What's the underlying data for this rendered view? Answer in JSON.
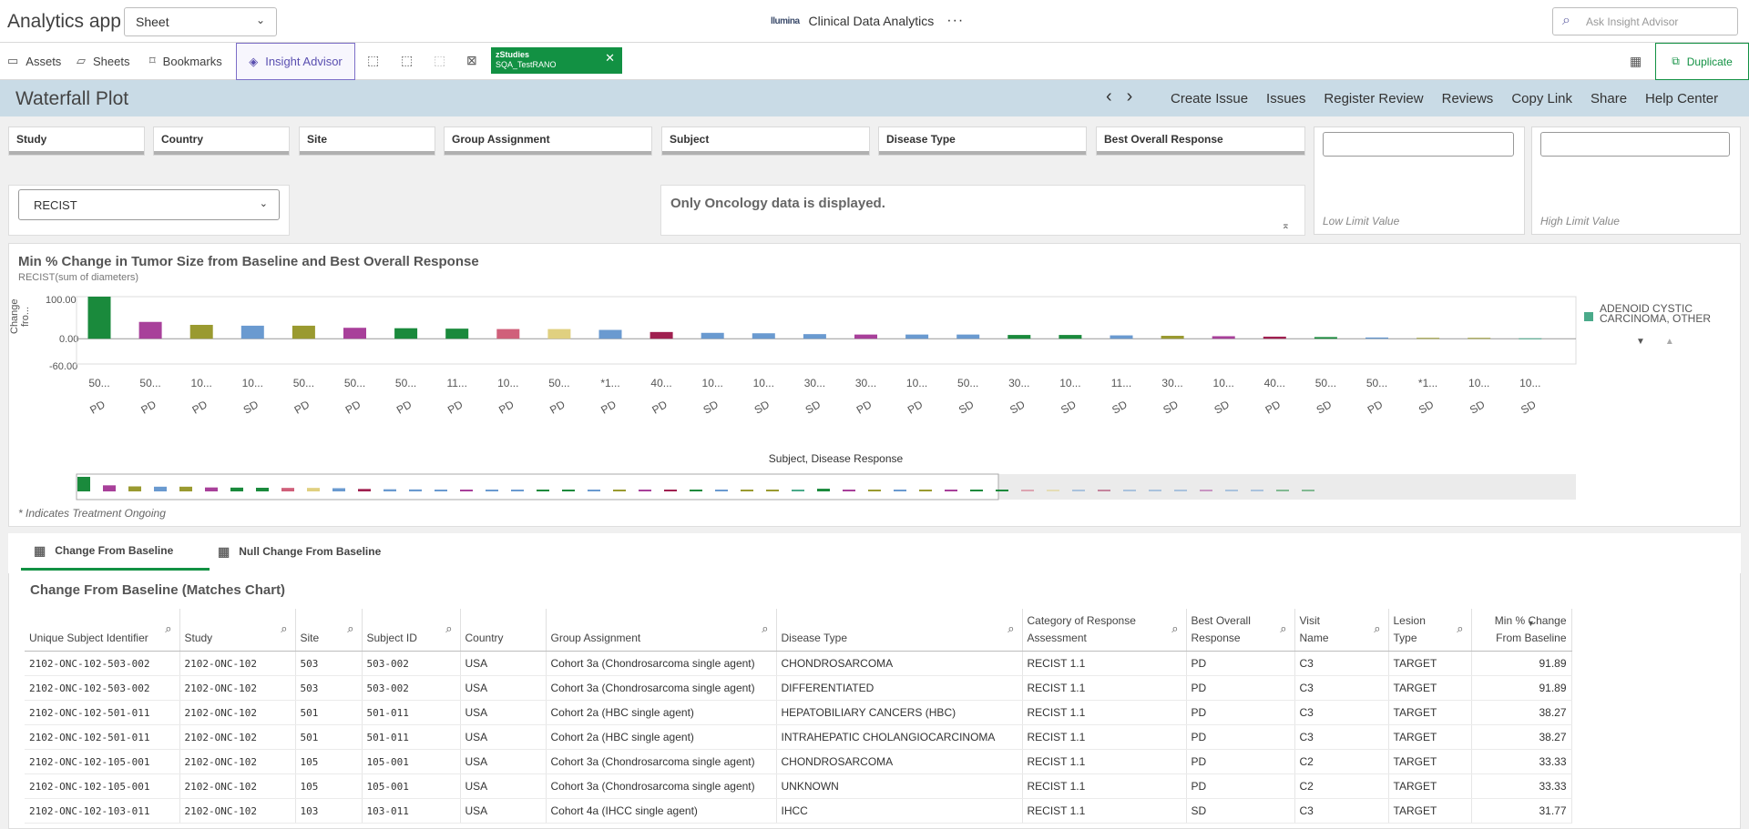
{
  "app": {
    "title": "Analytics app",
    "sheet_select": "Sheet",
    "center_title": "Clinical Data Analytics",
    "logo": "llumina",
    "search_placeholder": "Ask Insight Advisor"
  },
  "toolbar": {
    "assets": "Assets",
    "sheets": "Sheets",
    "bookmarks": "Bookmarks",
    "insight": "Insight Advisor",
    "study_tag_line1": "zStudies",
    "study_tag_line2": "SQA_TestRANO",
    "duplicate": "Duplicate"
  },
  "sheet": {
    "title": "Waterfall Plot",
    "actions": [
      "Create Issue",
      "Issues",
      "Register Review",
      "Reviews",
      "Copy Link",
      "Share",
      "Help Center"
    ]
  },
  "filters": [
    "Study",
    "Country",
    "Site",
    "Group Assignment",
    "Subject",
    "Disease Type",
    "Best Overall Response"
  ],
  "limits": {
    "low": "Low Limit Value",
    "high": "High Limit Value"
  },
  "criteria_select": "RECIST",
  "notice": "Only Oncology data is displayed.",
  "chart": {
    "title": "Min % Change in Tumor Size from Baseline and Best Overall Response",
    "subtitle": "RECIST(sum of diameters)",
    "ylabel": "Change fro...",
    "xlabel": "Subject, Disease Response",
    "legend_line1": "ADENOID CYSTIC",
    "legend_line2": "CARCINOMA, OTHER",
    "footnote": "* Indicates Treatment Ongoing"
  },
  "chart_data": {
    "type": "bar",
    "ylim": [
      -60,
      100
    ],
    "yticks": [
      "100.00",
      "0.00",
      "-60.00"
    ],
    "categories": [
      "50...",
      "50...",
      "10...",
      "10...",
      "50...",
      "50...",
      "50...",
      "11...",
      "10...",
      "50...",
      "*1...",
      "40...",
      "10...",
      "10...",
      "30...",
      "30...",
      "10...",
      "50...",
      "30...",
      "10...",
      "11...",
      "30...",
      "10...",
      "40...",
      "50...",
      "50...",
      "*1...",
      "10...",
      "10..."
    ],
    "responses": [
      "PD",
      "PD",
      "PD",
      "SD",
      "PD",
      "PD",
      "PD",
      "PD",
      "PD",
      "PD",
      "PD",
      "PD",
      "SD",
      "SD",
      "SD",
      "PD",
      "PD",
      "SD",
      "SD",
      "SD",
      "SD",
      "SD",
      "SD",
      "PD",
      "SD",
      "PD",
      "SD",
      "SD",
      "SD"
    ],
    "values": [
      100,
      40,
      33,
      31,
      31,
      26,
      25,
      24,
      23,
      23,
      21,
      16,
      14,
      13,
      11,
      10,
      10,
      10,
      9,
      9,
      8,
      7,
      6,
      5,
      4,
      3,
      2,
      2,
      1
    ],
    "colors": [
      "#1a8a3c",
      "#a8409a",
      "#9a9a30",
      "#6a9ad0",
      "#9a9a30",
      "#a8409a",
      "#1a8a3c",
      "#1a8a3c",
      "#d0607a",
      "#e0d080",
      "#6a9ad0",
      "#a02050",
      "#6a9ad0",
      "#6a9ad0",
      "#6a9ad0",
      "#a8409a",
      "#6a9ad0",
      "#6a9ad0",
      "#1a8a3c",
      "#1a8a3c",
      "#6a9ad0",
      "#9a9a30",
      "#a8409a",
      "#a02050",
      "#1a8a3c",
      "#6a9ad0",
      "#9a9a30",
      "#9a9a30",
      "#4aaa8a"
    ]
  },
  "tabs": [
    "Change From Baseline",
    "Null Change From Baseline"
  ],
  "table": {
    "title": "Change From Baseline (Matches Chart)",
    "headers": [
      "Unique Subject Identifier",
      "Study",
      "Site",
      "Subject ID",
      "Country",
      "Group Assignment",
      "Disease Type",
      "Category of Response Assessment",
      "Best Overall Response",
      "Visit Name",
      "Lesion Type",
      "Min % Change From Baseline"
    ],
    "rows": [
      [
        "2102-ONC-102-503-002",
        "2102-ONC-102",
        "503",
        "503-002",
        "USA",
        "Cohort 3a (Chondrosarcoma single agent)",
        "CHONDROSARCOMA",
        "RECIST 1.1",
        "PD",
        "C3",
        "TARGET",
        "91.89"
      ],
      [
        "2102-ONC-102-503-002",
        "2102-ONC-102",
        "503",
        "503-002",
        "USA",
        "Cohort 3a (Chondrosarcoma single agent)",
        "DIFFERENTIATED",
        "RECIST 1.1",
        "PD",
        "C3",
        "TARGET",
        "91.89"
      ],
      [
        "2102-ONC-102-501-011",
        "2102-ONC-102",
        "501",
        "501-011",
        "USA",
        "Cohort 2a (HBC single agent)",
        "HEPATOBILIARY CANCERS (HBC)",
        "RECIST 1.1",
        "PD",
        "C3",
        "TARGET",
        "38.27"
      ],
      [
        "2102-ONC-102-501-011",
        "2102-ONC-102",
        "501",
        "501-011",
        "USA",
        "Cohort 2a (HBC single agent)",
        "INTRAHEPATIC CHOLANGIOCARCINOMA",
        "RECIST 1.1",
        "PD",
        "C3",
        "TARGET",
        "38.27"
      ],
      [
        "2102-ONC-102-105-001",
        "2102-ONC-102",
        "105",
        "105-001",
        "USA",
        "Cohort 3a (Chondrosarcoma single agent)",
        "CHONDROSARCOMA",
        "RECIST 1.1",
        "PD",
        "C2",
        "TARGET",
        "33.33"
      ],
      [
        "2102-ONC-102-105-001",
        "2102-ONC-102",
        "105",
        "105-001",
        "USA",
        "Cohort 3a (Chondrosarcoma single agent)",
        "UNKNOWN",
        "RECIST 1.1",
        "PD",
        "C2",
        "TARGET",
        "33.33"
      ],
      [
        "2102-ONC-102-103-011",
        "2102-ONC-102",
        "103",
        "103-011",
        "USA",
        "Cohort 4a (IHCC single agent)",
        "IHCC",
        "RECIST 1.1",
        "SD",
        "C3",
        "TARGET",
        "31.77"
      ]
    ]
  }
}
